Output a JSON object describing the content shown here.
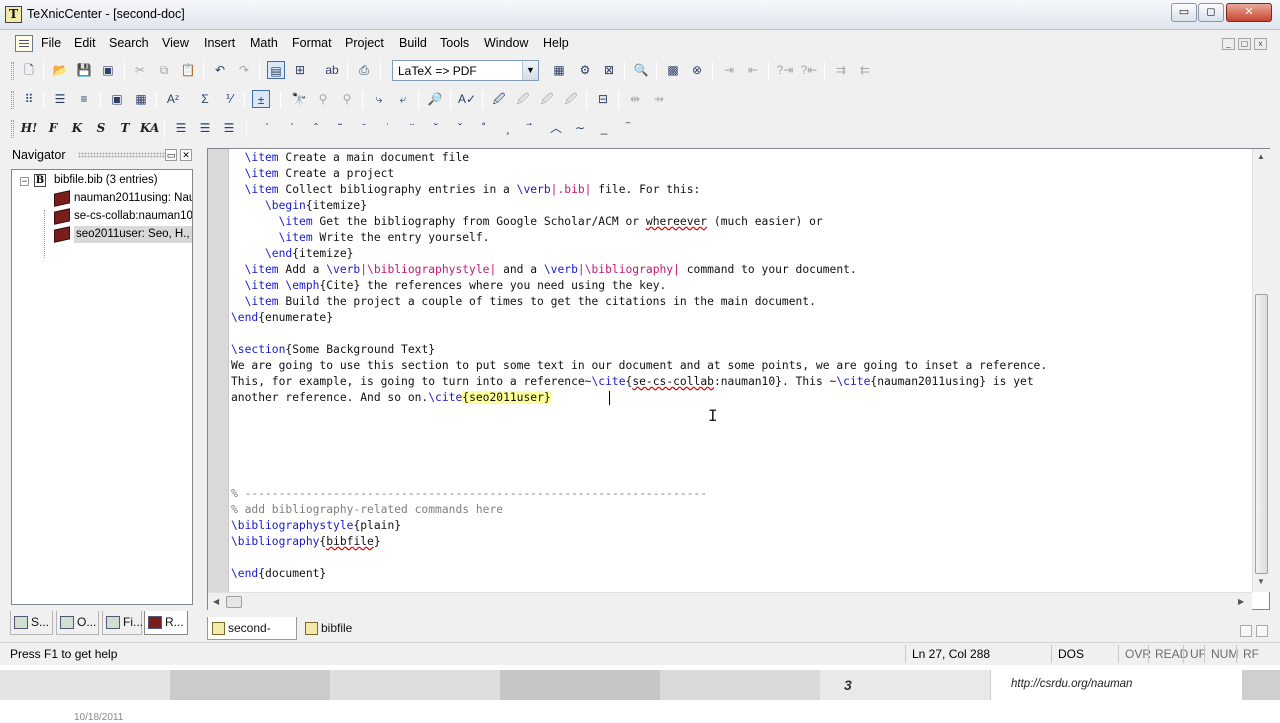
{
  "window": {
    "title": "TeXnicCenter - [second-doc]",
    "app_icon_letter": "T",
    "min_glyph": "▭",
    "max_glyph": "◻",
    "close_glyph": "✕"
  },
  "menu": [
    "File",
    "Edit",
    "Search",
    "View",
    "Insert",
    "Math",
    "Format",
    "Project",
    "Build",
    "Tools",
    "Window",
    "Help"
  ],
  "toolbar": {
    "build_profile": "LaTeX => PDF",
    "format_buttons": [
      "H!",
      "F",
      "K",
      "S",
      "T",
      "KA"
    ]
  },
  "navigator": {
    "title": "Navigator",
    "root": "bibfile.bib (3 entries)",
    "entries": [
      "nauman2011using: Nau",
      "se-cs-collab:nauman10:",
      "seo2011user: Seo, H., K"
    ],
    "tabs": [
      "S...",
      "O...",
      "Fi...",
      "R..."
    ]
  },
  "editor": {
    "lines": [
      [
        {
          "t": "  \\item",
          "c": "kw"
        },
        {
          "t": " Create a main document file",
          "c": "tx"
        }
      ],
      [
        {
          "t": "  \\item",
          "c": "kw"
        },
        {
          "t": " Create a project",
          "c": "tx"
        }
      ],
      [
        {
          "t": "  \\item",
          "c": "kw"
        },
        {
          "t": " Collect bibliography entries in a ",
          "c": "tx"
        },
        {
          "t": "\\verb",
          "c": "kw"
        },
        {
          "t": "|.bib|",
          "c": "vb"
        },
        {
          "t": " file. For this:",
          "c": "tx"
        }
      ],
      [
        {
          "t": "     \\begin",
          "c": "kw"
        },
        {
          "t": "{itemize}",
          "c": "tx"
        }
      ],
      [
        {
          "t": "       \\item",
          "c": "kw"
        },
        {
          "t": " Get the bibliography from Google Scholar/ACM or ",
          "c": "tx"
        },
        {
          "t": "whereever",
          "c": "tx squiggle"
        },
        {
          "t": " (much easier) or",
          "c": "tx"
        }
      ],
      [
        {
          "t": "       \\item",
          "c": "kw"
        },
        {
          "t": " Write the entry yourself.",
          "c": "tx"
        }
      ],
      [
        {
          "t": "     \\end",
          "c": "kw"
        },
        {
          "t": "{itemize}",
          "c": "tx"
        }
      ],
      [
        {
          "t": "  \\item",
          "c": "kw"
        },
        {
          "t": " Add a ",
          "c": "tx"
        },
        {
          "t": "\\verb",
          "c": "kw"
        },
        {
          "t": "|\\bibliographystyle|",
          "c": "vb"
        },
        {
          "t": " and a ",
          "c": "tx"
        },
        {
          "t": "\\verb",
          "c": "kw"
        },
        {
          "t": "|\\bibliography|",
          "c": "vb"
        },
        {
          "t": " command to your document.",
          "c": "tx"
        }
      ],
      [
        {
          "t": "  \\item",
          "c": "kw"
        },
        {
          "t": " ",
          "c": "tx"
        },
        {
          "t": "\\emph",
          "c": "kw"
        },
        {
          "t": "{Cite} the references where you need using the key.",
          "c": "tx"
        }
      ],
      [
        {
          "t": "  \\item",
          "c": "kw"
        },
        {
          "t": " Build the project a couple of times to get the citations in the main document.",
          "c": "tx"
        }
      ],
      [
        {
          "t": "\\end",
          "c": "kw"
        },
        {
          "t": "{enumerate}",
          "c": "tx"
        }
      ],
      [],
      [
        {
          "t": "\\section",
          "c": "kw"
        },
        {
          "t": "{Some Background Text}",
          "c": "tx"
        }
      ],
      [
        {
          "t": "We are going to use this section to put some text in our document and at some points, we are going to inset a reference.",
          "c": "tx"
        }
      ],
      [
        {
          "t": "This, for example, is going to turn into a reference~",
          "c": "tx"
        },
        {
          "t": "\\cite",
          "c": "kw"
        },
        {
          "t": "{",
          "c": "tx"
        },
        {
          "t": "se-cs-collab",
          "c": "tx squiggle"
        },
        {
          "t": ":nauman10}. This ~",
          "c": "tx"
        },
        {
          "t": "\\cite",
          "c": "kw"
        },
        {
          "t": "{nauman2011using} is yet",
          "c": "tx"
        }
      ],
      [
        {
          "t": "another reference. And so on.",
          "c": "tx"
        },
        {
          "t": "\\cite",
          "c": "kw"
        },
        {
          "t": "{seo2011user}",
          "c": "tx cite-hl"
        }
      ],
      [],
      [],
      [],
      [],
      [],
      [
        {
          "t": "% --------------------------------------------------------------------",
          "c": "cm"
        }
      ],
      [
        {
          "t": "% add bibliography-related commands here",
          "c": "cm"
        }
      ],
      [
        {
          "t": "\\bibliographystyle",
          "c": "kw"
        },
        {
          "t": "{plain}",
          "c": "tx"
        }
      ],
      [
        {
          "t": "\\bibliography",
          "c": "kw"
        },
        {
          "t": "{",
          "c": "tx"
        },
        {
          "t": "bibfile",
          "c": "tx squiggle"
        },
        {
          "t": "}",
          "c": "tx"
        }
      ],
      [],
      [
        {
          "t": "\\end",
          "c": "kw"
        },
        {
          "t": "{document}",
          "c": "tx"
        }
      ]
    ],
    "caret_line": 15,
    "caret_col": 47
  },
  "doc_tabs": [
    "second-doc",
    "bibfile"
  ],
  "status": {
    "help_text": "Press F1 to get help",
    "position": "Ln 27, Col 288",
    "line_ending": "DOS",
    "indicators": [
      "OVR",
      "READ",
      "UF",
      "NUM",
      "RF"
    ]
  },
  "footer": {
    "slide_number": "3",
    "url": "http://csrdu.org/nauman",
    "date": "10/18/2011"
  }
}
